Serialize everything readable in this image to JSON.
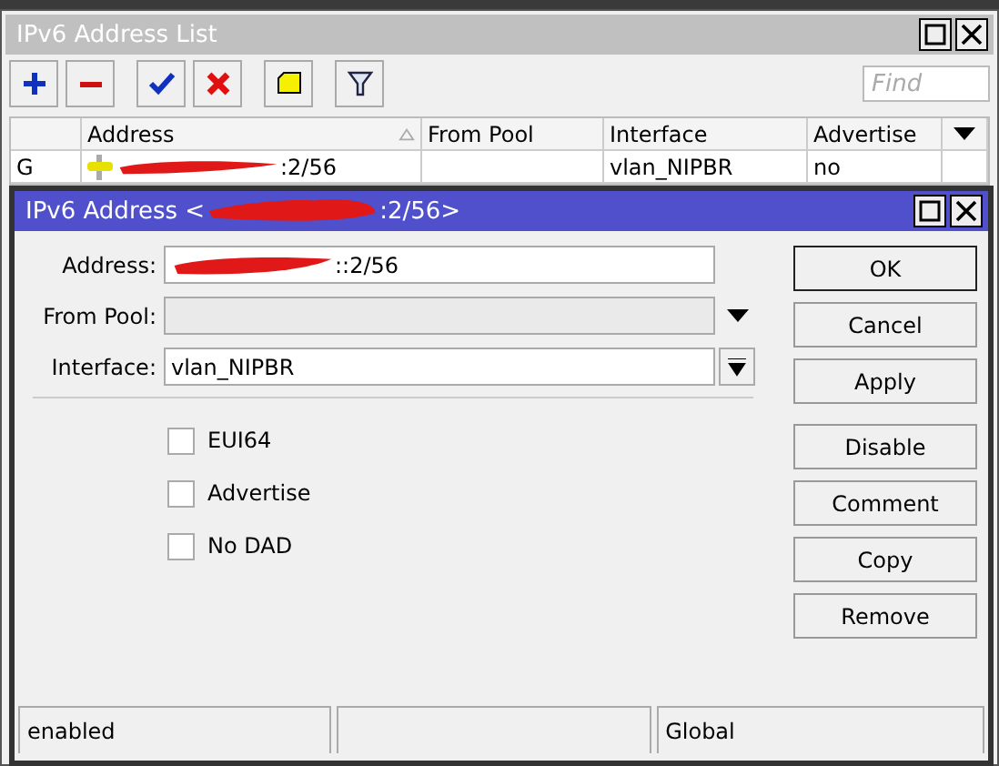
{
  "list_window": {
    "title": "IPv6 Address List",
    "search": {
      "placeholder": "Find"
    },
    "columns": [
      {
        "label": "Address",
        "sorted": true
      },
      {
        "label": "From Pool",
        "sorted": false
      },
      {
        "label": "Interface",
        "sorted": false
      },
      {
        "label": "Advertise",
        "sorted": false
      }
    ],
    "rows": [
      {
        "flag": "G",
        "address": ":2/56",
        "interface": "vlan_NIPBR",
        "advertise": "no"
      }
    ]
  },
  "dialog": {
    "title_start": "IPv6 Address <",
    "title_end": ":2/56>",
    "fields": [
      {
        "label": "Address:",
        "kind": "text",
        "value": "::2/56"
      },
      {
        "label": "From Pool:",
        "kind": "dropdown",
        "disabled": true
      },
      {
        "label": "Interface:",
        "kind": "select",
        "value": "vlan_NIPBR"
      }
    ],
    "checkboxes": [
      {
        "label": "EUI64",
        "checked": false
      },
      {
        "label": "Advertise",
        "checked": false
      },
      {
        "label": "No DAD",
        "checked": false
      }
    ],
    "buttons": [
      {
        "label": "OK",
        "default": true
      },
      {
        "label": "Cancel",
        "default": false
      },
      {
        "label": "Apply",
        "default": false
      },
      {
        "label": "Disable",
        "default": false
      },
      {
        "label": "Comment",
        "default": false
      },
      {
        "label": "Copy",
        "default": false
      },
      {
        "label": "Remove",
        "default": false
      }
    ],
    "status_bar": {
      "state": "enabled",
      "scope": "Global"
    }
  }
}
